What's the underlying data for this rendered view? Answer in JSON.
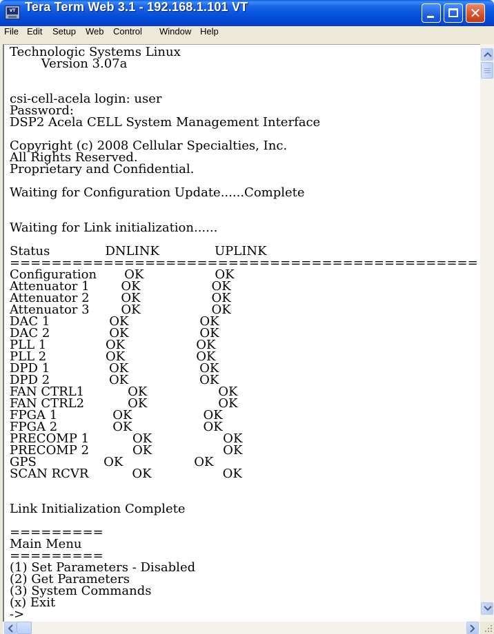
{
  "window": {
    "title": "Tera Term Web 3.1 - 192.168.1.101 VT",
    "app_icon_text": "VT"
  },
  "menu": [
    "File",
    "Edit",
    "Setup",
    "Web",
    "Control",
    "Window",
    "Help"
  ],
  "terminal": {
    "lines": [
      "Technologic Systems Linux",
      "        Version 3.07a",
      "",
      "",
      "csi-cell-acela login: user",
      "Password:",
      "DSP2 Acela CELL System Management Interface",
      "",
      "Copyright (c) 2008 Cellular Specialties, Inc.",
      "All Rights Reserved.",
      "Proprietary and Confidential.",
      "",
      "Waiting for Configuration Update......Complete",
      "",
      "",
      "Waiting for Link initialization......",
      "",
      "Status              DNLINK              UPLINK",
      "=============================================",
      "Configuration       OK                  OK",
      "Attenuator 1        OK                  OK",
      "Attenuator 2        OK                  OK",
      "Attenuator 3        OK                  OK",
      "DAC 1               OK                  OK",
      "DAC 2               OK                  OK",
      "PLL 1               OK                  OK",
      "PLL 2               OK                  OK",
      "DPD 1               OK                  OK",
      "DPD 2               OK                  OK",
      "FAN CTRL1           OK                  OK",
      "FAN CTRL2           OK                  OK",
      "FPGA 1              OK                  OK",
      "FPGA 2              OK                  OK",
      "PRECOMP 1           OK                  OK",
      "PRECOMP 2           OK                  OK",
      "GPS                 OK                  OK",
      "SCAN RCVR           OK                  OK",
      "",
      "",
      "Link Initialization Complete",
      "",
      "=========",
      "Main Menu",
      "=========",
      "(1) Set Parameters - Disabled",
      "(2) Get Parameters",
      "(3) System Commands",
      "(x) Exit",
      "->"
    ]
  }
}
